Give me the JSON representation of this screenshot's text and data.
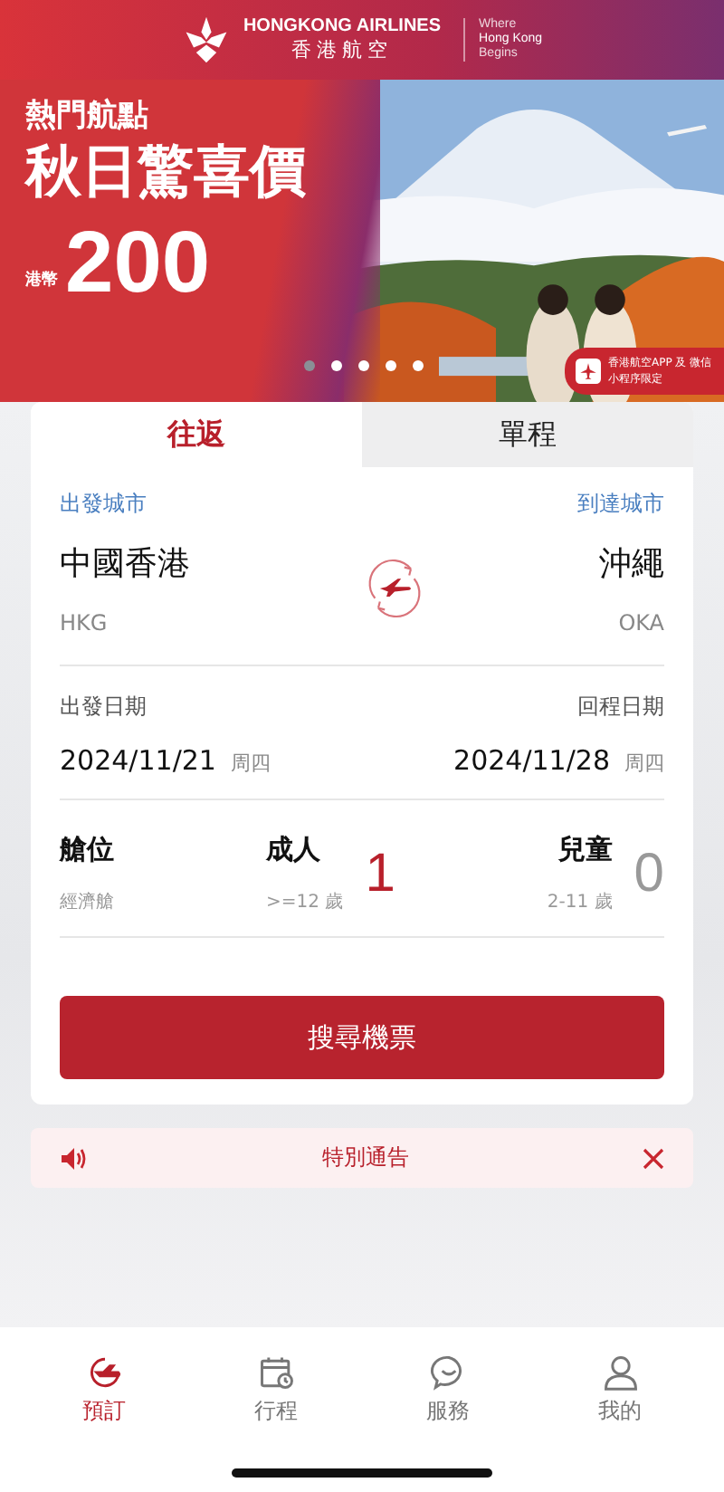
{
  "header": {
    "brand_en": "HONGKONG AIRLINES",
    "brand_zh": "香港航空",
    "slogan": [
      "Where",
      "Hong Kong",
      "Begins"
    ]
  },
  "banner": {
    "subtitle": "熱門航點",
    "title": "秋日驚喜價",
    "currency": "港幣",
    "price": "200",
    "app_badge": "香港航空APP 及 微信小程序限定",
    "kind": "picture",
    "dots": [
      {
        "selected": true
      },
      {
        "selected": false
      },
      {
        "selected": false
      },
      {
        "selected": false
      },
      {
        "selected": false
      }
    ]
  },
  "trip_tabs": [
    {
      "label": "往返",
      "selected": true
    },
    {
      "label": "單程",
      "selected": false
    }
  ],
  "route": {
    "from_label": "出發城市",
    "to_label": "到達城市",
    "from_city": "中國香港",
    "to_city": "沖繩",
    "from_code": "HKG",
    "to_code": "OKA"
  },
  "dates": {
    "depart_label": "出發日期",
    "return_label": "回程日期",
    "depart_date": "2024/11/21",
    "depart_day": "周四",
    "return_date": "2024/11/28",
    "return_day": "周四"
  },
  "passengers": {
    "cabin_label": "艙位",
    "cabin_value": "經濟艙",
    "adult_label": "成人",
    "adult_hint": ">=12 歲",
    "adult_count": "1",
    "child_label": "兒童",
    "child_hint": "2-11 歲",
    "child_count": "0"
  },
  "search_button": "搜尋機票",
  "notice": {
    "text": "特別通告"
  },
  "nav": [
    {
      "label": "預訂",
      "kind": "book",
      "selected": true
    },
    {
      "label": "行程",
      "kind": "trip",
      "selected": false
    },
    {
      "label": "服務",
      "kind": "chat",
      "selected": false
    },
    {
      "label": "我的",
      "kind": "user",
      "selected": false
    }
  ]
}
